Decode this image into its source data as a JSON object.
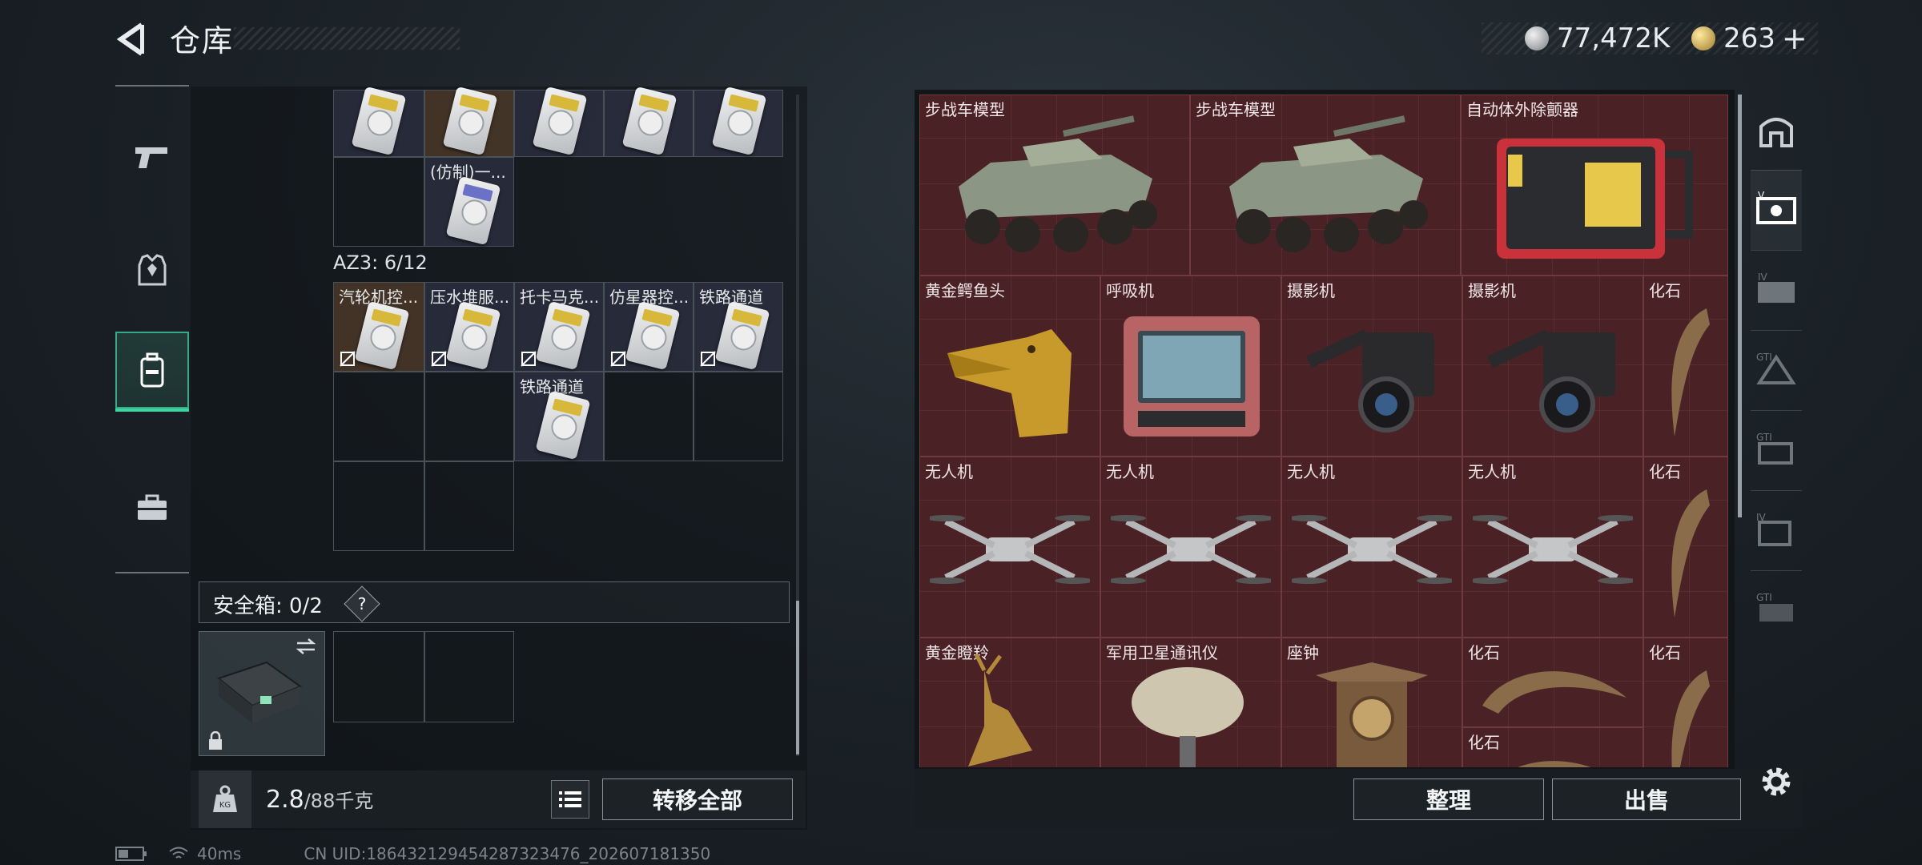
{
  "header": {
    "title": "仓库",
    "silver_amount": "77,472K",
    "gold_amount": "263",
    "gold_plus": "+"
  },
  "left_nav": [
    "weapon-icon",
    "armor-icon",
    "backpack-icon",
    "briefcase-icon"
  ],
  "left_panel": {
    "top_row_labels": [
      "",
      "",
      "",
      "",
      ""
    ],
    "partial_row_label": "(仿制)一...",
    "az3_label": "AZ3: 6/12",
    "az3_items": [
      "汽轮机控...",
      "压水堆服...",
      "托卡马克...",
      "仿星器控...",
      "铁路通道"
    ],
    "az3_second_row_item": "铁路通道",
    "safe_box_label": "安全箱: 0/2",
    "help_glyph": "?",
    "weight_value": "2.8",
    "weight_capacity": "/88千克",
    "transfer_all_label": "转移全部"
  },
  "right_panel": {
    "items": [
      {
        "label": "步战车模型"
      },
      {
        "label": "步战车模型"
      },
      {
        "label": "自动体外除颤器"
      },
      {
        "label": "黄金鳄鱼头"
      },
      {
        "label": "呼吸机"
      },
      {
        "label": "摄影机"
      },
      {
        "label": "摄影机"
      },
      {
        "label": "化石"
      },
      {
        "label": "无人机"
      },
      {
        "label": "无人机"
      },
      {
        "label": "无人机"
      },
      {
        "label": "无人机"
      },
      {
        "label": "化石"
      },
      {
        "label": "黄金瞪羚"
      },
      {
        "label": "军用卫星通讯仪"
      },
      {
        "label": "座钟"
      },
      {
        "label": "化石"
      },
      {
        "label": "化石"
      },
      {
        "label": "化石"
      }
    ],
    "organize_label": "整理",
    "sell_label": "出售"
  },
  "status_bar": {
    "ping": "40ms",
    "uid": "CN UID:186432129454287323476_202607181350"
  },
  "colors": {
    "accent_green": "#3fd39f",
    "vault_red": "#4a2226"
  }
}
